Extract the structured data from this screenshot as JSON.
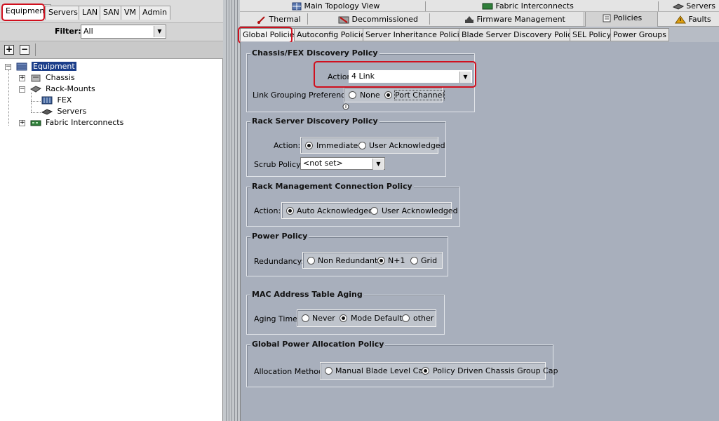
{
  "nav": {
    "tabs": [
      "Equipment",
      "Servers",
      "LAN",
      "SAN",
      "VM",
      "Admin"
    ],
    "active_tab": "Equipment",
    "filter_label": "Filter:",
    "filter_value": "All",
    "expand_label": "+",
    "collapse_label": "−"
  },
  "tree": {
    "root": "Equipment",
    "chassis": "Chassis",
    "rack_mounts": "Rack-Mounts",
    "fex": "FEX",
    "servers": "Servers",
    "fabric_interconnects": "Fabric Interconnects"
  },
  "top_tabs": {
    "main_topology": "Main Topology View",
    "fabric_interconnects": "Fabric Interconnects",
    "servers": "Servers",
    "thermal": "Thermal",
    "decommissioned": "Decommissioned",
    "firmware": "Firmware Management",
    "policies": "Policies",
    "faults": "Faults"
  },
  "sub_tabs": [
    "Global Policies",
    "Autoconfig Policies",
    "Server Inheritance Policies",
    "Blade Server Discovery Policies",
    "SEL Policy",
    "Power Groups"
  ],
  "chassis_fex": {
    "title": "Chassis/FEX Discovery Policy",
    "action_label": "Action:",
    "action_value": "4 Link",
    "link_grouping_label": "Link Grouping Preference:",
    "options": [
      "None",
      "Port Channel"
    ],
    "selected": "Port Channel"
  },
  "rack_discovery": {
    "title": "Rack Server Discovery Policy",
    "action_label": "Action:",
    "options": [
      "Immediate",
      "User Acknowledged"
    ],
    "selected": "Immediate",
    "scrub_label": "Scrub Policy:",
    "scrub_value": "<not set>"
  },
  "rack_mgmt": {
    "title": "Rack Management Connection Policy",
    "action_label": "Action:",
    "options": [
      "Auto Acknowledged",
      "User Acknowledged"
    ],
    "selected": "Auto Acknowledged"
  },
  "power": {
    "title": "Power Policy",
    "redundancy_label": "Redundancy:",
    "options": [
      "Non Redundant",
      "N+1",
      "Grid"
    ],
    "selected": "N+1"
  },
  "mac_aging": {
    "title": "MAC Address Table Aging",
    "aging_label": "Aging Time:",
    "options": [
      "Never",
      "Mode Default",
      "other"
    ],
    "selected": "Mode Default"
  },
  "power_alloc": {
    "title": "Global Power Allocation Policy",
    "method_label": "Allocation Method:",
    "options": [
      "Manual Blade Level Cap",
      "Policy Driven Chassis Group Cap"
    ],
    "selected": "Policy Driven Chassis Group Cap"
  },
  "colors": {
    "highlight": "#d0101e",
    "content_bg": "#a8afbc",
    "tree_selected": "#1b3e8a"
  }
}
